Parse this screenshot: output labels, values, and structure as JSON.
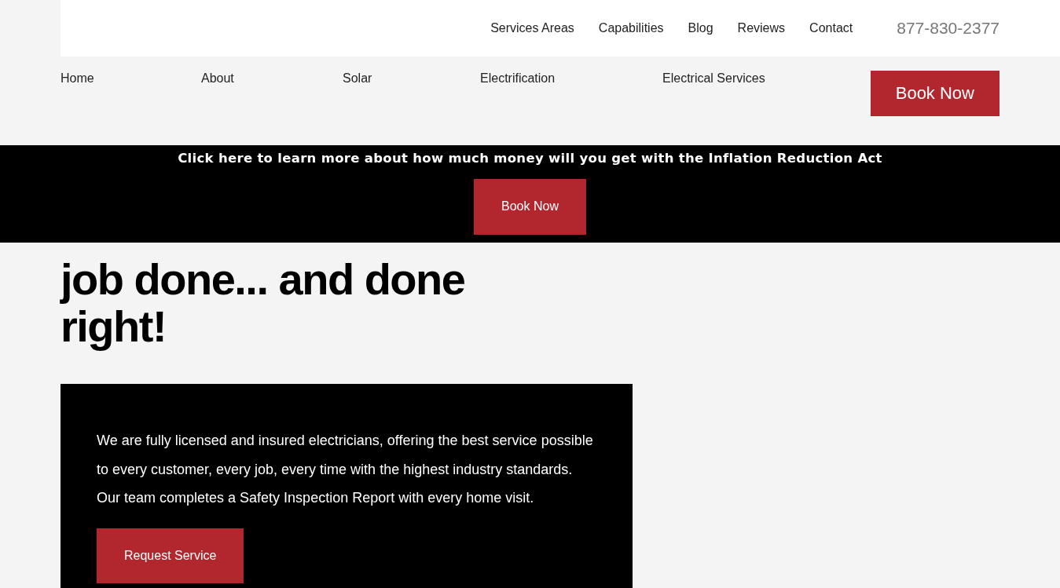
{
  "top_nav": {
    "links": [
      "Services Areas",
      "Capabilities",
      "Blog",
      "Reviews",
      "Contact"
    ],
    "phone": "877-830-2377"
  },
  "main_nav": {
    "links": [
      "Home",
      "About",
      "Solar",
      "Electrification",
      "Electrical Services"
    ],
    "button": "Book Now"
  },
  "banner": {
    "text": "Click here to learn more about how much money will you get with the Inflation Reduction Act",
    "button": "Book Now"
  },
  "hero": {
    "heading_lines": [
      "job done... and done",
      "right!"
    ],
    "card": {
      "text": "We are fully licensed and insured electricians, offering the best service possible to every customer, every job, every time with the highest industry standards. Our team completes a Safety Inspection Report with every home visit.",
      "button": "Request Service"
    }
  }
}
